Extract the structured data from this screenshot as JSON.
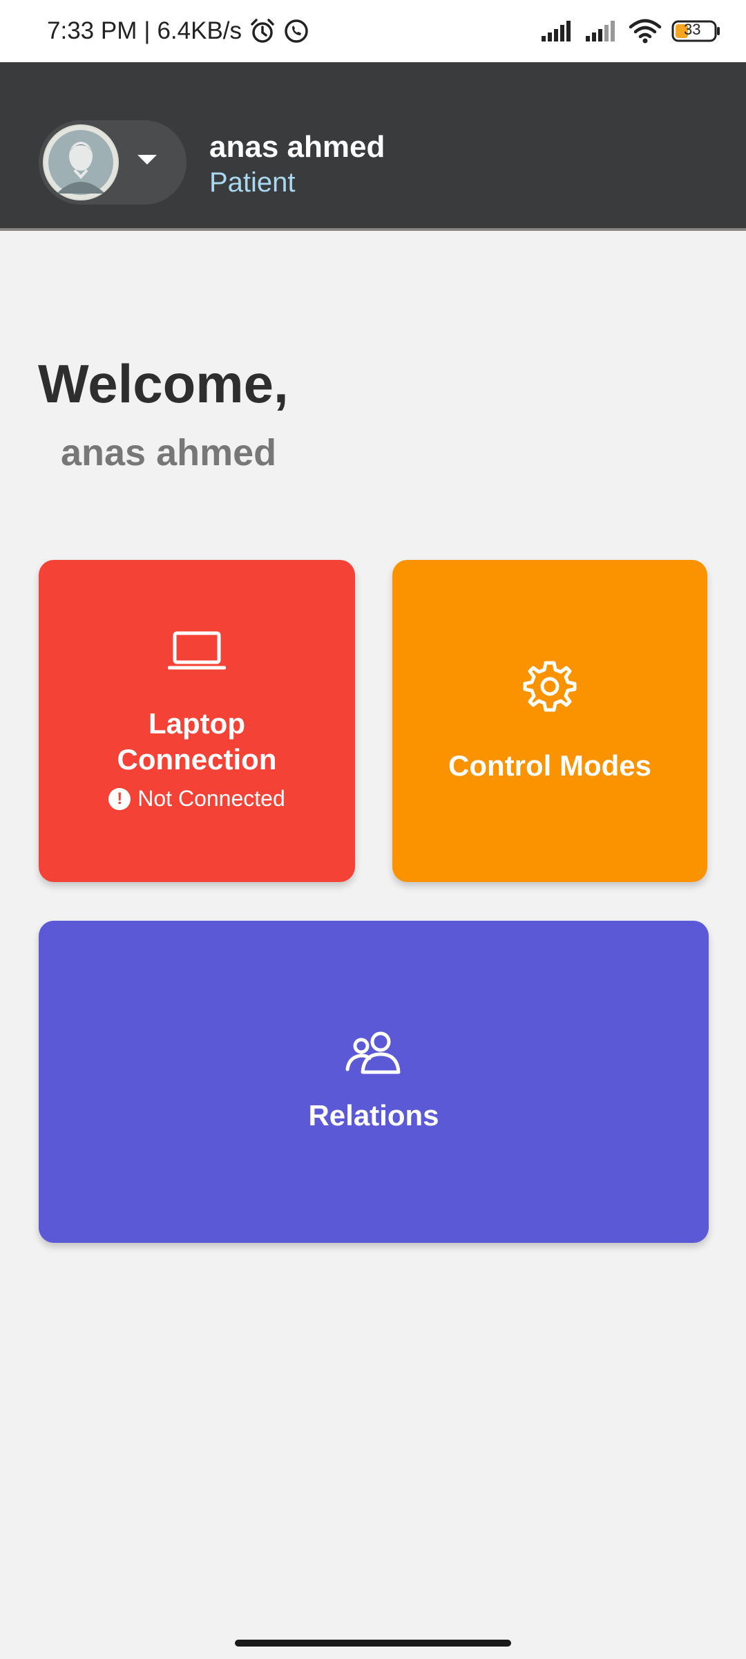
{
  "status_bar": {
    "time": "7:33 PM",
    "separator": "|",
    "speed": "6.4KB/s",
    "battery": "33",
    "icons": [
      "alarm-icon",
      "whatsapp-icon",
      "signal-icon",
      "signal-icon",
      "wifi-icon",
      "battery-icon"
    ]
  },
  "header": {
    "user_name": "anas ahmed",
    "user_role": "Patient",
    "avatar_icon": "user-avatar",
    "switch_icon": "caret-down-icon"
  },
  "welcome": {
    "title": "Welcome,",
    "name": "anas ahmed"
  },
  "cards": {
    "laptop": {
      "title_line1": "Laptop",
      "title_line2": "Connection",
      "status": "Not Connected",
      "icon": "laptop-icon",
      "color": "#f44336"
    },
    "control": {
      "title": "Control Modes",
      "icon": "gear-icon",
      "color": "#fb9300"
    },
    "relations": {
      "title": "Relations",
      "icon": "people-icon",
      "color": "#5b59d6"
    }
  }
}
